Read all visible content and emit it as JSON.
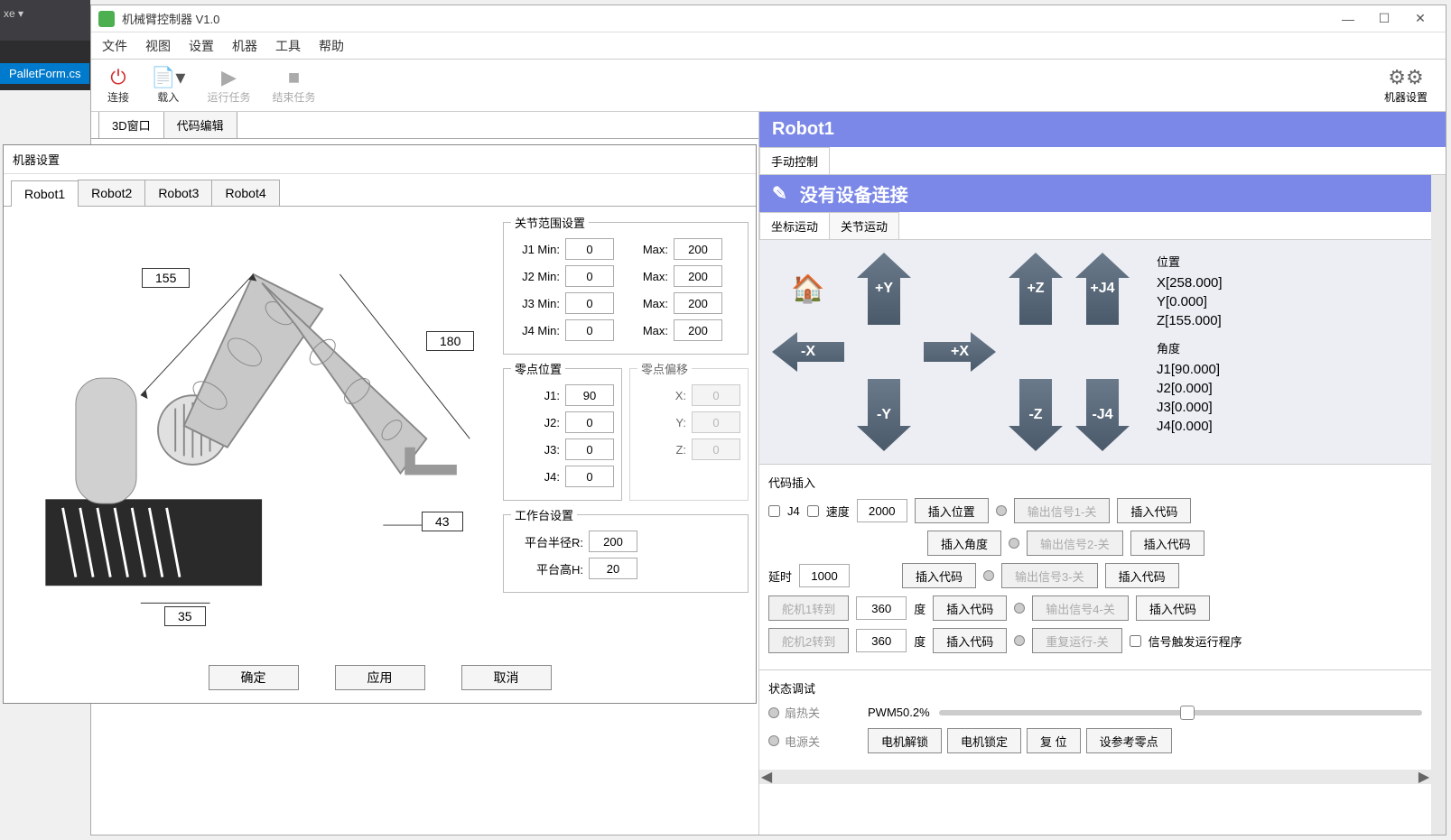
{
  "ide": {
    "tab": "PalletForm.cs",
    "exe": "xe"
  },
  "window": {
    "title": "机械臂控制器 V1.0"
  },
  "menu": {
    "file": "文件",
    "view": "视图",
    "settings": "设置",
    "machine": "机器",
    "tools": "工具",
    "help": "帮助"
  },
  "toolbar": {
    "connect": "连接",
    "load": "载入",
    "run": "运行任务",
    "stop": "结束任务",
    "machine_settings": "机器设置"
  },
  "view_tabs": {
    "t3d": "3D窗口",
    "code": "代码编辑"
  },
  "dialog": {
    "title": "机器设置",
    "tabs": [
      "Robot1",
      "Robot2",
      "Robot3",
      "Robot4"
    ],
    "dims": {
      "d1": "155",
      "d2": "180",
      "d3": "43",
      "d4": "35"
    },
    "joint_range": {
      "legend": "关节范围设置",
      "rows": [
        {
          "min_lbl": "J1 Min:",
          "min": "0",
          "max_lbl": "Max:",
          "max": "200"
        },
        {
          "min_lbl": "J2 Min:",
          "min": "0",
          "max_lbl": "Max:",
          "max": "200"
        },
        {
          "min_lbl": "J3 Min:",
          "min": "0",
          "max_lbl": "Max:",
          "max": "200"
        },
        {
          "min_lbl": "J4 Min:",
          "min": "0",
          "max_lbl": "Max:",
          "max": "200"
        }
      ]
    },
    "zero_pos": {
      "legend": "零点位置",
      "rows": [
        {
          "lbl": "J1:",
          "val": "90"
        },
        {
          "lbl": "J2:",
          "val": "0"
        },
        {
          "lbl": "J3:",
          "val": "0"
        },
        {
          "lbl": "J4:",
          "val": "0"
        }
      ]
    },
    "zero_offset": {
      "legend": "零点偏移",
      "rows": [
        {
          "lbl": "X:",
          "val": "0"
        },
        {
          "lbl": "Y:",
          "val": "0"
        },
        {
          "lbl": "Z:",
          "val": "0"
        }
      ]
    },
    "worktable": {
      "legend": "工作台设置",
      "r_lbl": "平台半径R:",
      "r": "200",
      "h_lbl": "平台高H:",
      "h": "20"
    },
    "ok": "确定",
    "apply": "应用",
    "cancel": "取消"
  },
  "right": {
    "header": "Robot1",
    "ctrl_tab": "手动控制",
    "banner": "没有设备连接",
    "motion_tabs": {
      "coord": "坐标运动",
      "joint": "关节运动"
    },
    "jog": {
      "plus_y": "+Y",
      "minus_y": "-Y",
      "plus_x": "+X",
      "minus_x": "-X",
      "plus_z": "+Z",
      "minus_z": "-Z",
      "plus_j4": "+J4",
      "minus_j4": "-J4"
    },
    "pos": {
      "pos_lbl": "位置",
      "x": "X[258.000]",
      "y": "Y[0.000]",
      "z": "Z[155.000]",
      "ang_lbl": "角度",
      "j1": "J1[90.000]",
      "j2": "J2[0.000]",
      "j3": "J3[0.000]",
      "j4": "J4[0.000]"
    },
    "code_insert": {
      "legend": "代码插入",
      "j4": "J4",
      "speed_lbl": "速度",
      "speed": "2000",
      "insert_pos": "插入位置",
      "insert_angle": "插入角度",
      "out1": "输出信号1-关",
      "out2": "输出信号2-关",
      "out3": "输出信号3-关",
      "out4": "输出信号4-关",
      "repeat": "重复运行-关",
      "insert_code": "插入代码",
      "delay_lbl": "延时",
      "delay": "1000",
      "servo1": "舵机1转到",
      "servo2": "舵机2转到",
      "servo_val": "360",
      "deg": "度",
      "signal_trigger": "信号触发运行程序"
    },
    "status": {
      "legend": "状态调试",
      "fan": "扇热关",
      "pwm": "PWM50.2%",
      "power": "电源关",
      "unlock": "电机解锁",
      "lock": "电机锁定",
      "reset": "复 位",
      "home": "设参考零点"
    }
  }
}
